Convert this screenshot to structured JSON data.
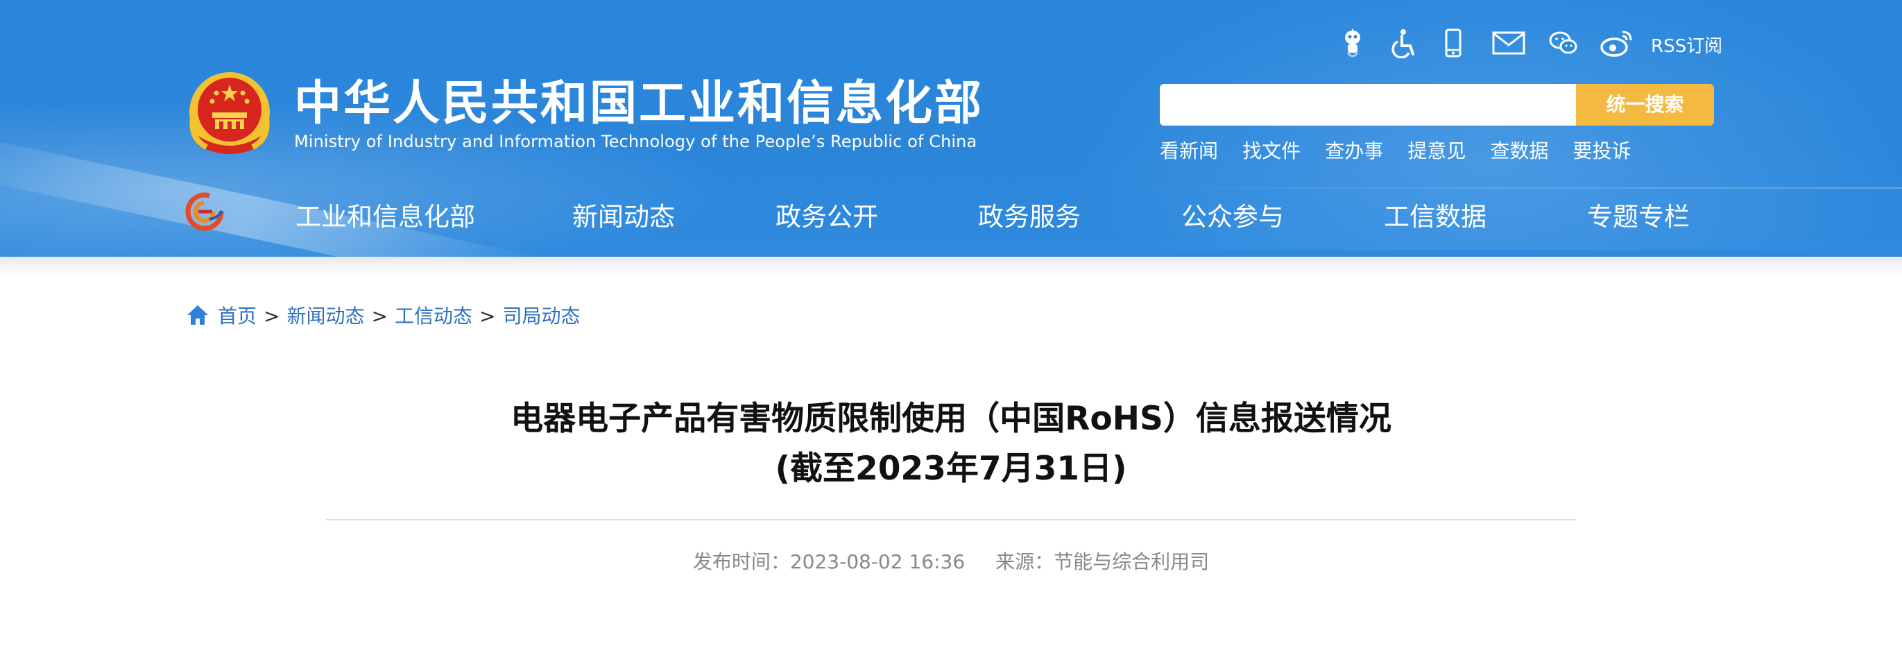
{
  "header": {
    "title_cn": "中华人民共和国工业和信息化部",
    "title_en": "Ministry of Industry and Information Technology of the People’s Republic of China",
    "utility_icons": [
      "robot-assistant-icon",
      "accessibility-icon",
      "mobile-icon",
      "mail-icon",
      "wechat-icon",
      "weibo-icon"
    ],
    "rss_label": "RSS订阅",
    "search": {
      "placeholder": "",
      "button_label": "统一搜索"
    },
    "quick_links": [
      "看新闻",
      "找文件",
      "查办事",
      "提意见",
      "查数据",
      "要投诉"
    ],
    "colors": {
      "header_bg": "#2b86da",
      "search_button": "#f4b940"
    }
  },
  "nav": {
    "items": [
      "工业和信息化部",
      "新闻动态",
      "政务公开",
      "政务服务",
      "公众参与",
      "工信数据",
      "专题专栏"
    ]
  },
  "breadcrumb": {
    "items": [
      "首页",
      "新闻动态",
      "工信动态",
      "司局动态"
    ],
    "separator": ">"
  },
  "article": {
    "title_line1": "电器电子产品有害物质限制使用（中国RoHS）信息报送情况",
    "title_line2": "(截至2023年7月31日)",
    "publish_label": "发布时间：",
    "publish_time": "2023-08-02 16:36",
    "source_label": "来源：",
    "source": "节能与综合利用司"
  }
}
